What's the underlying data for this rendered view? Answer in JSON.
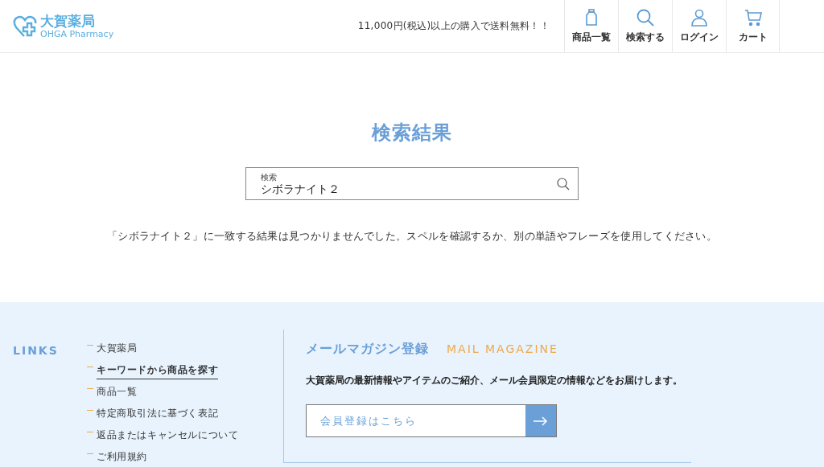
{
  "header": {
    "logo": {
      "name": "大賀薬局",
      "subtitle": "OHGA Pharmacy"
    },
    "notice": "11,000円(税込)以上の購入で送料無料！！",
    "nav": [
      {
        "kind": "bottle",
        "label": "商品一覧"
      },
      {
        "kind": "search",
        "label": "検索する"
      },
      {
        "kind": "user",
        "label": "ログイン"
      },
      {
        "kind": "cart",
        "label": "カート"
      }
    ]
  },
  "main": {
    "title": "検索結果",
    "search": {
      "label": "検索",
      "value": "シボラナイト２"
    },
    "message": "「シボラナイト２」に一致する結果は見つかりませんでした。スペルを確認するか、別の単語やフレーズを使用してください。"
  },
  "footer": {
    "links_heading": "LINKS",
    "links": [
      {
        "label": "大賀薬局",
        "selected": false
      },
      {
        "label": "キーワードから商品を探す",
        "selected": true
      },
      {
        "label": "商品一覧",
        "selected": false
      },
      {
        "label": "特定商取引法に基づく表記",
        "selected": false
      },
      {
        "label": "返品またはキャンセルについて",
        "selected": false
      },
      {
        "label": "ご利用規約",
        "selected": false
      }
    ],
    "mail": {
      "title": "メールマガジン登録",
      "title_en": "MAIL MAGAZINE",
      "description": "大賀薬局の最新情報やアイテムのご紹介、メール会員限定の情報などをお届けします。",
      "button": "会員登録はこちら"
    }
  }
}
